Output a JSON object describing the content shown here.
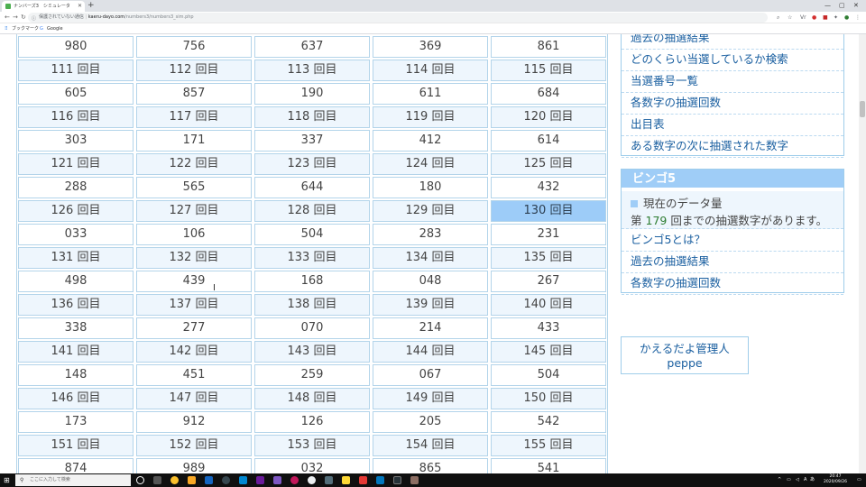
{
  "browser": {
    "tab_title": "ナンバーズ3　シミュレータ",
    "new_tab": "+",
    "url_insecure": "保護されていない通信",
    "url_host": "kaeru-dayo.com",
    "url_path": "/numbers3/numbers3_sim.php",
    "bookmarks_label": "ブックマーク",
    "google_label": "Google",
    "profile_label": "Vr"
  },
  "results": {
    "rows": [
      {
        "type": "num",
        "cells": [
          "980",
          "756",
          "637",
          "369",
          "861"
        ]
      },
      {
        "type": "label",
        "cells": [
          "111 回目",
          "112 回目",
          "113 回目",
          "114 回目",
          "115 回目"
        ]
      },
      {
        "type": "num",
        "cells": [
          "605",
          "857",
          "190",
          "611",
          "684"
        ]
      },
      {
        "type": "label",
        "cells": [
          "116 回目",
          "117 回目",
          "118 回目",
          "119 回目",
          "120 回目"
        ]
      },
      {
        "type": "num",
        "cells": [
          "303",
          "171",
          "337",
          "412",
          "614"
        ]
      },
      {
        "type": "label",
        "cells": [
          "121 回目",
          "122 回目",
          "123 回目",
          "124 回目",
          "125 回目"
        ]
      },
      {
        "type": "num",
        "cells": [
          "288",
          "565",
          "644",
          "180",
          "432"
        ]
      },
      {
        "type": "label",
        "cells": [
          "126 回目",
          "127 回目",
          "128 回目",
          "129 回目",
          "130 回目"
        ]
      },
      {
        "type": "num",
        "cells": [
          "033",
          "106",
          "504",
          "283",
          "231"
        ]
      },
      {
        "type": "label",
        "cells": [
          "131 回目",
          "132 回目",
          "133 回目",
          "134 回目",
          "135 回目"
        ]
      },
      {
        "type": "num",
        "cells": [
          "498",
          "439",
          "168",
          "048",
          "267"
        ]
      },
      {
        "type": "label",
        "cells": [
          "136 回目",
          "137 回目",
          "138 回目",
          "139 回目",
          "140 回目"
        ]
      },
      {
        "type": "num",
        "cells": [
          "338",
          "277",
          "070",
          "214",
          "433"
        ]
      },
      {
        "type": "label",
        "cells": [
          "141 回目",
          "142 回目",
          "143 回目",
          "144 回目",
          "145 回目"
        ]
      },
      {
        "type": "num",
        "cells": [
          "148",
          "451",
          "259",
          "067",
          "504"
        ]
      },
      {
        "type": "label",
        "cells": [
          "146 回目",
          "147 回目",
          "148 回目",
          "149 回目",
          "150 回目"
        ]
      },
      {
        "type": "num",
        "cells": [
          "173",
          "912",
          "126",
          "205",
          "542"
        ]
      },
      {
        "type": "label",
        "cells": [
          "151 回目",
          "152 回目",
          "153 回目",
          "154 回目",
          "155 回目"
        ]
      },
      {
        "type": "num",
        "cells": [
          "874",
          "989",
          "032",
          "865",
          "541"
        ]
      }
    ],
    "selected_label": "130 回目"
  },
  "sidebar": {
    "numbers_links": [
      "過去の抽選結果",
      "どのくらい当選しているか検索",
      "当選番号一覧",
      "各数字の抽選回数",
      "出目表",
      "ある数字の次に抽選された数字"
    ],
    "bingo": {
      "title": "ビンゴ5",
      "info_label": "現在のデータ量",
      "info_prefix": "第",
      "info_count": "179",
      "info_suffix": "回までの抽選数字があります。",
      "links": [
        "ビンゴ5とは？",
        "過去の抽選結果",
        "各数字の抽選回数"
      ]
    },
    "admin": {
      "line1": "かえるだよ管理人",
      "line2": "peppe"
    }
  },
  "taskbar": {
    "search_placeholder": "ここに入力して検索",
    "time": "20:47",
    "date": "2020/09/26",
    "lang": "A",
    "ime": "あ"
  }
}
